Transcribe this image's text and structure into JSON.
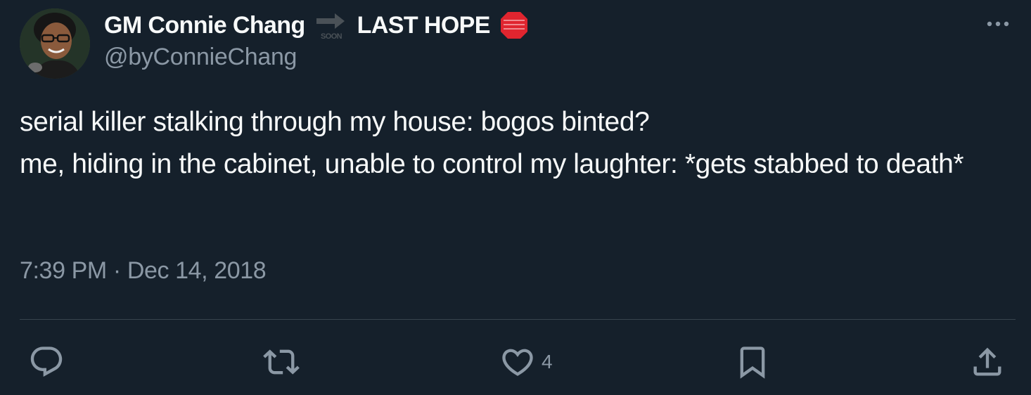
{
  "author": {
    "display_name_part1": "GM Connie Chang",
    "soon_emoji_text": "SOON",
    "display_name_part2": "LAST HOPE",
    "handle": "@byConnieChang",
    "avatar_icon": "avatar-photo"
  },
  "tweet": {
    "text": "serial killer stalking through my house: bogos binted?\nme, hiding in the cabinet, unable to control my laughter: *gets stabbed to death*",
    "time": "7:39 PM",
    "separator": "·",
    "date": "Dec 14, 2018"
  },
  "actions": {
    "reply_icon": "reply-icon",
    "retweet_icon": "retweet-icon",
    "like_icon": "heart-icon",
    "like_count": "4",
    "bookmark_icon": "bookmark-icon",
    "share_icon": "share-icon"
  },
  "colors": {
    "background": "#15202b",
    "primary_text": "#f7f9f9",
    "secondary_text": "#8b98a5",
    "divider": "#38444d",
    "stop_sign": "#e0252f"
  }
}
